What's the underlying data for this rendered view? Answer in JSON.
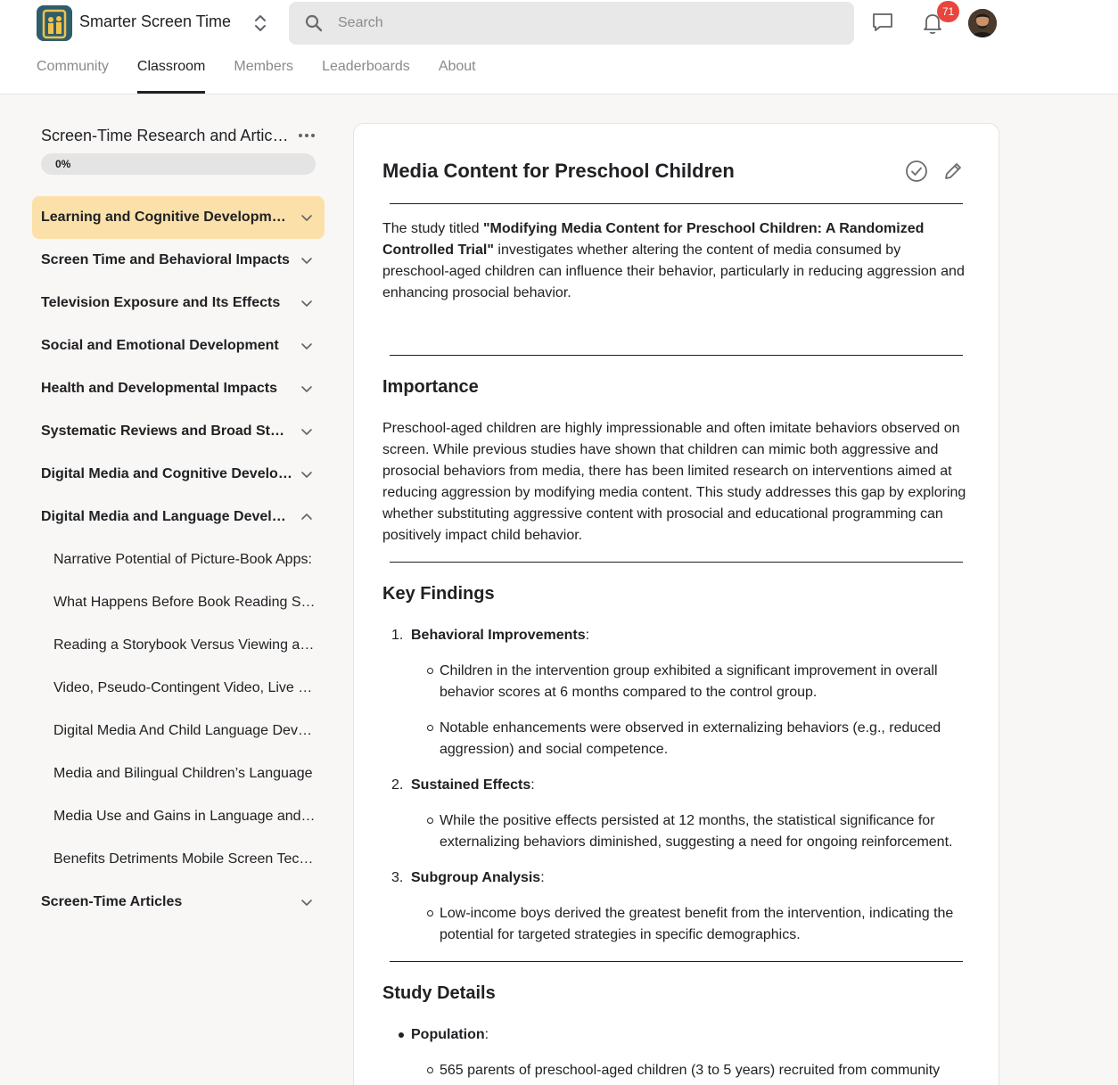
{
  "app": {
    "title": "Smarter Screen Time",
    "notifications_count": "71"
  },
  "search": {
    "placeholder": "Search"
  },
  "tabs": [
    {
      "label": "Community",
      "active": false
    },
    {
      "label": "Classroom",
      "active": true
    },
    {
      "label": "Members",
      "active": false
    },
    {
      "label": "Leaderboards",
      "active": false
    },
    {
      "label": "About",
      "active": false
    }
  ],
  "course": {
    "title": "Screen-Time Research and Articles",
    "progress_label": "0%",
    "progress": 0
  },
  "modules": [
    {
      "label": "Learning and Cognitive Development",
      "active": true,
      "expanded": false
    },
    {
      "label": "Screen Time and Behavioral Impacts",
      "active": false,
      "expanded": false
    },
    {
      "label": "Television Exposure and Its Effects",
      "active": false,
      "expanded": false
    },
    {
      "label": "Social and Emotional Development",
      "active": false,
      "expanded": false
    },
    {
      "label": "Health and Developmental Impacts",
      "active": false,
      "expanded": false
    },
    {
      "label": "Systematic Reviews and Broad Studies",
      "active": false,
      "expanded": false
    },
    {
      "label": "Digital Media and Cognitive Development",
      "active": false,
      "expanded": false
    },
    {
      "label": "Digital Media and Language Development",
      "active": false,
      "expanded": true,
      "lessons": [
        "Narrative Potential of Picture-Book Apps:",
        "What Happens Before Book Reading Starts",
        "Reading a Storybook Versus Viewing a Video",
        "Video, Pseudo-Contingent Video, Live Book",
        "Digital Media And Child Language Development",
        "Media and Bilingual Children’s Language",
        "Media Use and Gains in Language and Literacy",
        "Benefits Detriments Mobile Screen Technology"
      ]
    },
    {
      "label": "Screen-Time Articles",
      "active": false,
      "expanded": false
    }
  ],
  "post": {
    "title": "Media Content for Preschool Children",
    "intro_prefix": "The study titled ",
    "intro_bold": "\"Modifying Media Content for Preschool Children: A Randomized Controlled Trial\"",
    "intro_suffix": " investigates whether altering the content of media consumed by preschool-aged children can influence their behavior, particularly in reducing aggression and enhancing prosocial behavior.",
    "importance_heading": "Importance",
    "importance_text": "Preschool-aged children are highly impressionable and often imitate behaviors observed on screen. While previous studies have shown that children can mimic both aggressive and prosocial behaviors from media, there has been limited research on interventions aimed at reducing aggression by modifying media content. This study addresses this gap by exploring whether substituting aggressive content with prosocial and educational programming can positively impact child behavior.",
    "findings_heading": "Key Findings",
    "findings": [
      {
        "num": "1.",
        "title": "Behavioral Improvements",
        "points": [
          "Children in the intervention group exhibited a significant improvement in overall behavior scores at 6 months compared to the control group.",
          "Notable enhancements were observed in externalizing behaviors (e.g., reduced aggression) and social competence."
        ]
      },
      {
        "num": "2.",
        "title": "Sustained Effects",
        "points": [
          "While the positive effects persisted at 12 months, the statistical significance for externalizing behaviors diminished, suggesting a need for ongoing reinforcement."
        ]
      },
      {
        "num": "3.",
        "title": "Subgroup Analysis",
        "points": [
          "Low-income boys derived the greatest benefit from the intervention, indicating the potential for targeted strategies in specific demographics."
        ]
      }
    ],
    "details_heading": "Study Details",
    "details": [
      {
        "title": "Population",
        "points": [
          "565 parents of preschool-aged children (3 to 5 years) recruited from community"
        ]
      }
    ],
    "colon": ":"
  },
  "colors": {
    "accent": "#fbe1a9",
    "badge": "#e8453c",
    "logo": "#2f5d6b"
  },
  "icons": [
    "app-logo-icon",
    "switch-icon",
    "search-icon",
    "chat-icon",
    "bell-icon",
    "more-icon",
    "chevron-down-icon",
    "chevron-up-icon",
    "check-circle-icon",
    "pencil-icon"
  ]
}
